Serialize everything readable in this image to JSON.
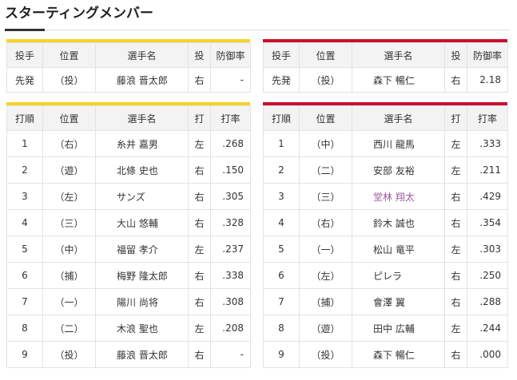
{
  "page": {
    "title": "スターティングメンバー"
  },
  "colors": {
    "home_accent": "#f5d327",
    "away_accent": "#c8102e",
    "highlight_name": "#9b5a9b"
  },
  "pitchers": {
    "headers": {
      "role": "投手",
      "pos": "位置",
      "name": "選手名",
      "throws": "投",
      "era": "防御率"
    },
    "left": {
      "role": "先発",
      "pos": "（投）",
      "name": "藤浪 晋太郎",
      "throws": "右",
      "era": "-"
    },
    "right": {
      "role": "先発",
      "pos": "（投）",
      "name": "森下 暢仁",
      "throws": "右",
      "era": "2.18"
    }
  },
  "batters": {
    "headers": {
      "order": "打順",
      "pos": "位置",
      "name": "選手名",
      "bats": "打",
      "avg": "打率"
    },
    "left": [
      {
        "order": "1",
        "pos": "（右）",
        "name": "糸井 嘉男",
        "bats": "左",
        "avg": ".268"
      },
      {
        "order": "2",
        "pos": "（遊）",
        "name": "北條 史也",
        "bats": "右",
        "avg": ".150"
      },
      {
        "order": "3",
        "pos": "（左）",
        "name": "サンズ",
        "bats": "右",
        "avg": ".305"
      },
      {
        "order": "4",
        "pos": "（三）",
        "name": "大山 悠輔",
        "bats": "右",
        "avg": ".328"
      },
      {
        "order": "5",
        "pos": "（中）",
        "name": "福留 孝介",
        "bats": "左",
        "avg": ".237"
      },
      {
        "order": "6",
        "pos": "（捕）",
        "name": "梅野 隆太郎",
        "bats": "右",
        "avg": ".338"
      },
      {
        "order": "7",
        "pos": "（一）",
        "name": "陽川 尚将",
        "bats": "右",
        "avg": ".308"
      },
      {
        "order": "8",
        "pos": "（二）",
        "name": "木浪 聖也",
        "bats": "左",
        "avg": ".208"
      },
      {
        "order": "9",
        "pos": "（投）",
        "name": "藤浪 晋太郎",
        "bats": "右",
        "avg": "-"
      }
    ],
    "right": [
      {
        "order": "1",
        "pos": "（中）",
        "name": "西川 龍馬",
        "bats": "左",
        "avg": ".333"
      },
      {
        "order": "2",
        "pos": "（二）",
        "name": "安部 友裕",
        "bats": "左",
        "avg": ".211"
      },
      {
        "order": "3",
        "pos": "（三）",
        "name": "堂林 翔太",
        "bats": "右",
        "avg": ".429"
      },
      {
        "order": "4",
        "pos": "（右）",
        "name": "鈴木 誠也",
        "bats": "右",
        "avg": ".354"
      },
      {
        "order": "5",
        "pos": "（一）",
        "name": "松山 竜平",
        "bats": "左",
        "avg": ".303"
      },
      {
        "order": "6",
        "pos": "（左）",
        "name": "ピレラ",
        "bats": "右",
        "avg": ".250"
      },
      {
        "order": "7",
        "pos": "（捕）",
        "name": "會澤 翼",
        "bats": "右",
        "avg": ".288"
      },
      {
        "order": "8",
        "pos": "（遊）",
        "name": "田中 広輔",
        "bats": "左",
        "avg": ".244"
      },
      {
        "order": "9",
        "pos": "（投）",
        "name": "森下 暢仁",
        "bats": "右",
        "avg": ".000"
      }
    ]
  }
}
